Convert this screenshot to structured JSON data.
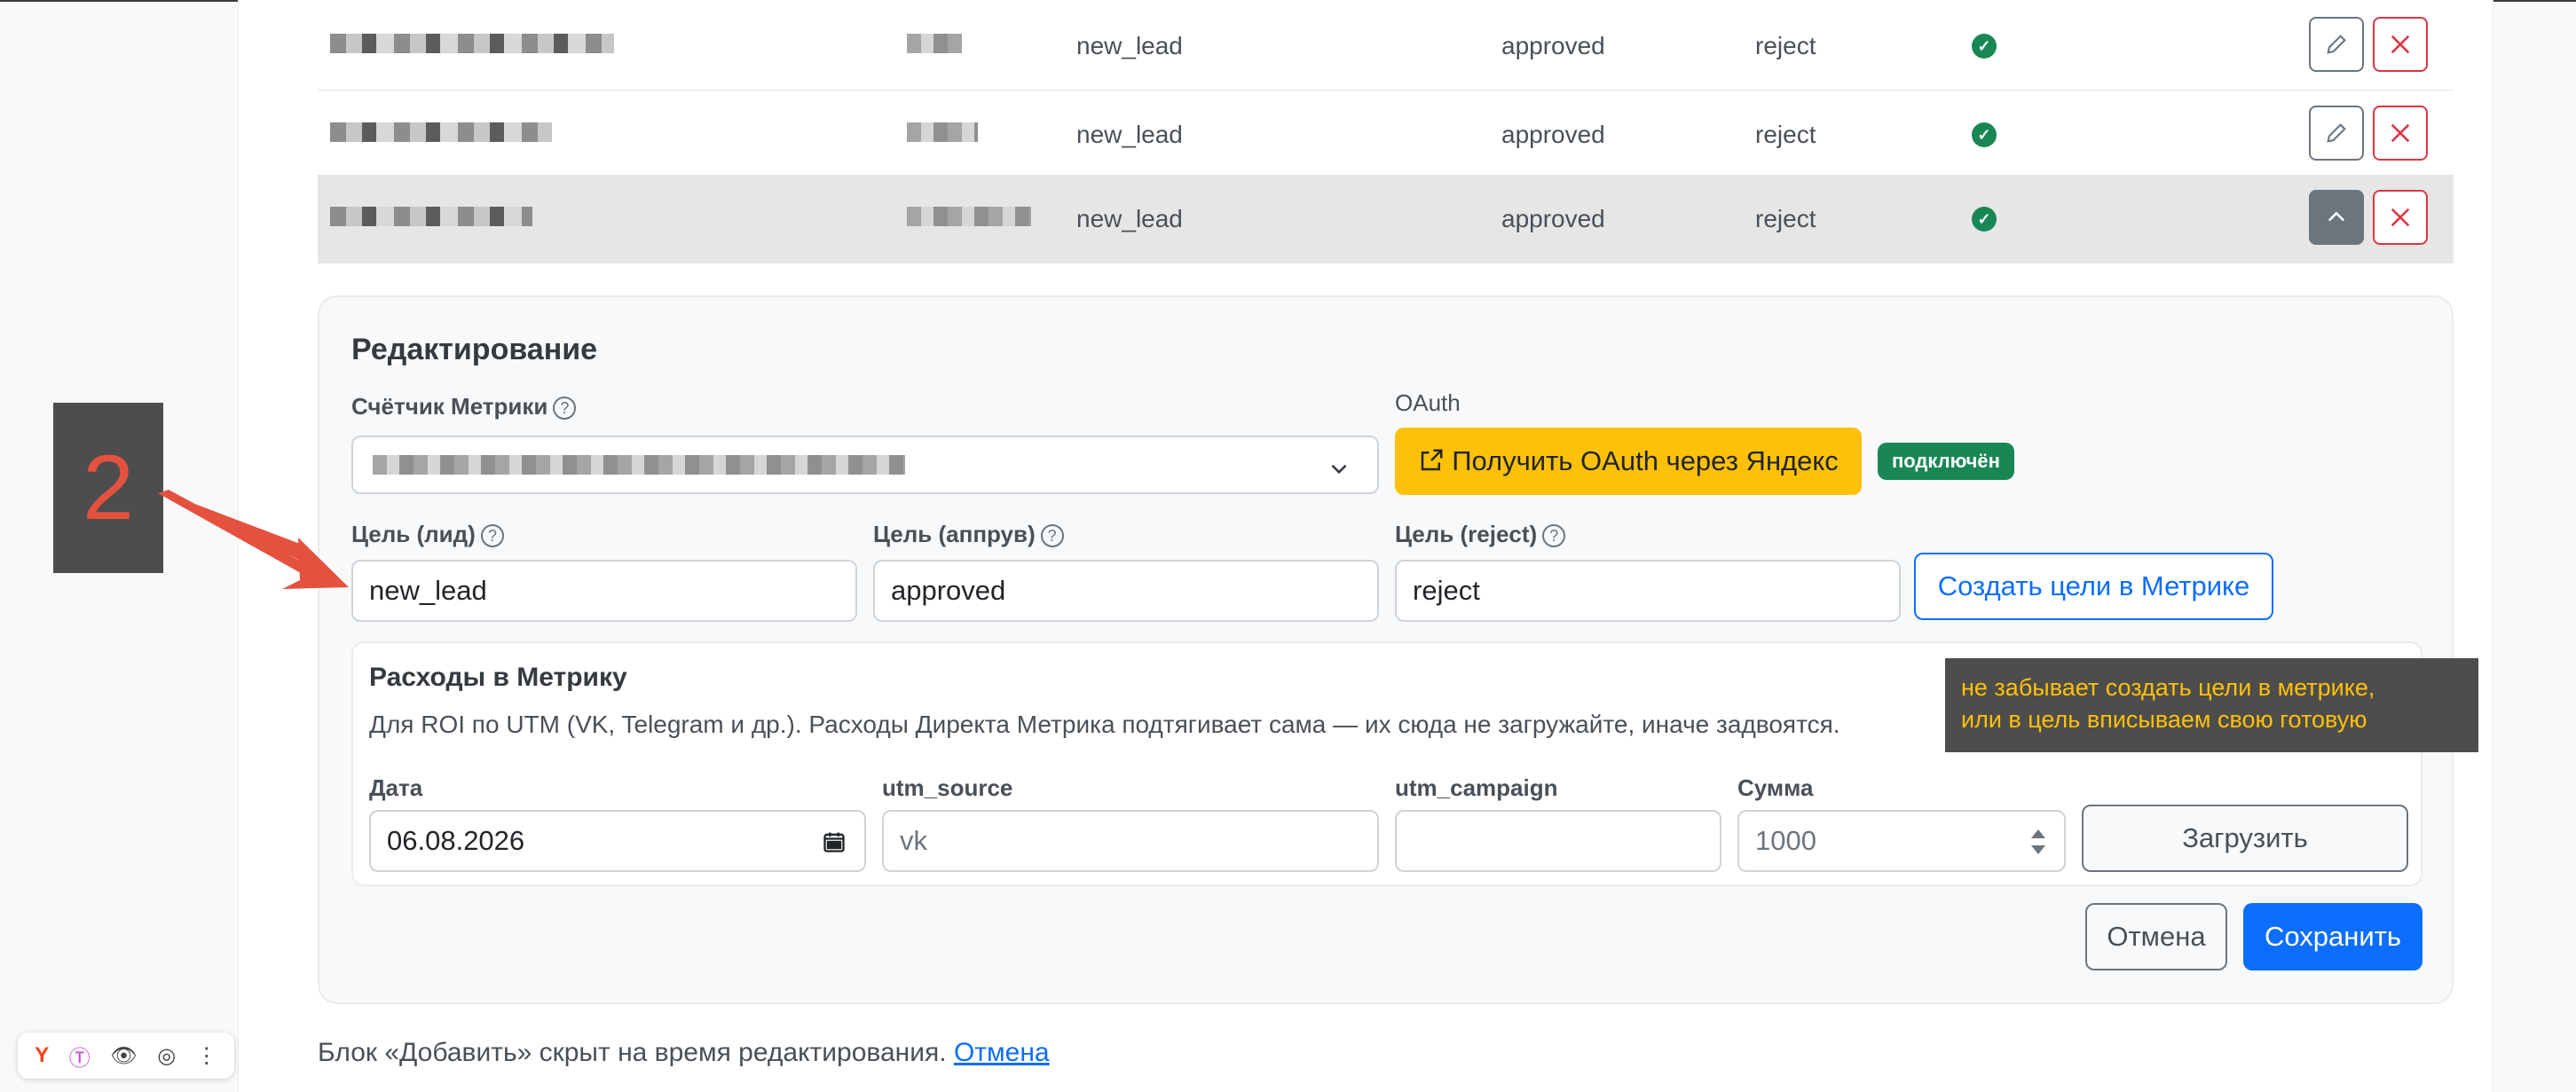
{
  "table": {
    "rows": [
      {
        "goal_lead": "new_lead",
        "goal_approve": "approved",
        "goal_reject": "reject",
        "status": "✓"
      },
      {
        "goal_lead": "new_lead",
        "goal_approve": "approved",
        "goal_reject": "reject",
        "status": "✓"
      },
      {
        "goal_lead": "new_lead",
        "goal_approve": "approved",
        "goal_reject": "reject",
        "status": "✓"
      }
    ]
  },
  "editor": {
    "title": "Редактирование",
    "counter_label": "Счётчик Метрики",
    "oauth_label": "OAuth",
    "oauth_button": "Получить OAuth через Яндекс",
    "oauth_status": "подключён",
    "goal_lead_label": "Цель (лид)",
    "goal_lead_value": "new_lead",
    "goal_approve_label": "Цель (аппрув)",
    "goal_approve_value": "approved",
    "goal_reject_label": "Цель (reject)",
    "goal_reject_value": "reject",
    "create_goals_button": "Создать цели в Метрике",
    "help_glyph": "?"
  },
  "spend": {
    "title": "Расходы в Метрику",
    "description": "Для ROI по UTM (VK, Telegram и др.). Расходы Директа Метрика подтягивает сама — их сюда не загружайте, иначе задвоятся.",
    "date_label": "Дата",
    "date_value": "06.08.2026",
    "utm_source_label": "utm_source",
    "utm_source_placeholder": "vk",
    "utm_campaign_label": "utm_campaign",
    "utm_campaign_value": "",
    "amount_label": "Сумма",
    "amount_placeholder": "1000",
    "upload_button": "Загрузить"
  },
  "actions": {
    "cancel": "Отмена",
    "save": "Сохранить"
  },
  "footer": {
    "note": "Блок «Добавить» скрыт на время редактирования.",
    "link": "Отмена"
  },
  "annotation": {
    "step": "2",
    "note_line1": "не забывает создать цели в метрике,",
    "note_line2": "или в цель вписываем свою готовую"
  },
  "colors": {
    "primary": "#0d6efd",
    "warning": "#ffc107",
    "success": "#198754",
    "danger": "#dc3545",
    "annotation_red": "#e4523f"
  },
  "extension_toolbar": {
    "icons": [
      "yandex-icon",
      "translate-icon",
      "eye-icon",
      "screenshot-icon",
      "more-icon"
    ]
  }
}
